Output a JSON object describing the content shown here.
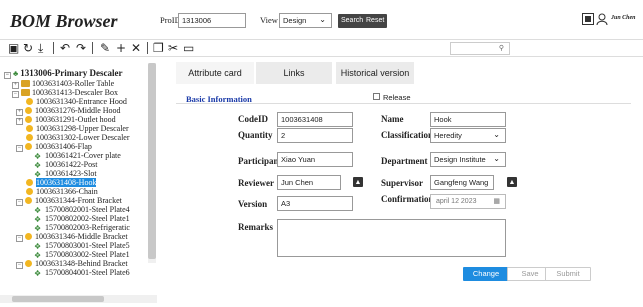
{
  "header": {
    "title": "BOM Browser",
    "proid_label": "ProID",
    "proid_value": "1313006",
    "view_label": "View",
    "view_value": "Design",
    "search_label": "Search",
    "reset_label": "Reset",
    "user_name": "Jun Chen"
  },
  "toolbar": {
    "icons": [
      "save-icon",
      "refresh-icon",
      "download-icon",
      "undo-icon",
      "redo-icon",
      "edit-icon",
      "add-icon",
      "delete-icon",
      "copy-icon",
      "cut-icon",
      "paste-icon",
      "search-icon"
    ]
  },
  "tree": {
    "root": "1313006-Primary Descaler",
    "items": [
      "1003631403-Roller Table",
      "1003631413-Descaler Box",
      "1003631340-Entrance Hood",
      "1003631276-Middle Hood",
      "1003631291-Outlet hood",
      "1003631298-Upper Descaler",
      "1003631302-Lower Descaler",
      "1003631406-Flap",
      "100361421-Cover plate",
      "100361422-Post",
      "100361423-Slot",
      "1003631408-Hook",
      "1003631366-Chain",
      "1003631344-Front Bracket",
      "15700802001-Steel Plate4",
      "15700802002-Steel Plate1",
      "15700802003-Refrigeratic",
      "1003631346-Middle Bracket",
      "15700803001-Steel Plate5",
      "15700803002-Steel Plate1",
      "1003631348-Behind Bracket",
      "15700804001-Steel Plate6"
    ]
  },
  "tabs": [
    "Attribute card",
    "Links",
    "Historical version"
  ],
  "form": {
    "section_title": "Basic Information",
    "release_label": "Release",
    "codeid_label": "CodeID",
    "codeid_value": "1003631408",
    "name_label": "Name",
    "name_value": "Hook",
    "quantity_label": "Quantity",
    "quantity_value": "2",
    "classification_label": "Classification",
    "classification_value": "Heredity",
    "participant_label": "Participant",
    "participant_value": "Xiao Yuan",
    "department_label": "Department",
    "department_value": "Design Institute",
    "reviewer_label": "Reviewer",
    "reviewer_value": "Jun Chen",
    "supervisor_label": "Supervisor",
    "supervisor_value": "Gangfeng Wang",
    "version_label": "Version",
    "version_value": "A3",
    "confirmation_label": "Confirmation",
    "confirmation_value": "april 12 2023",
    "remarks_label": "Remarks",
    "remarks_value": ""
  },
  "actions": {
    "change_label": "Change",
    "save_label": "Save",
    "submit_label": "Submit"
  },
  "colors": {
    "accent": "#1e8ce0",
    "section_title": "#1a3aa8"
  }
}
